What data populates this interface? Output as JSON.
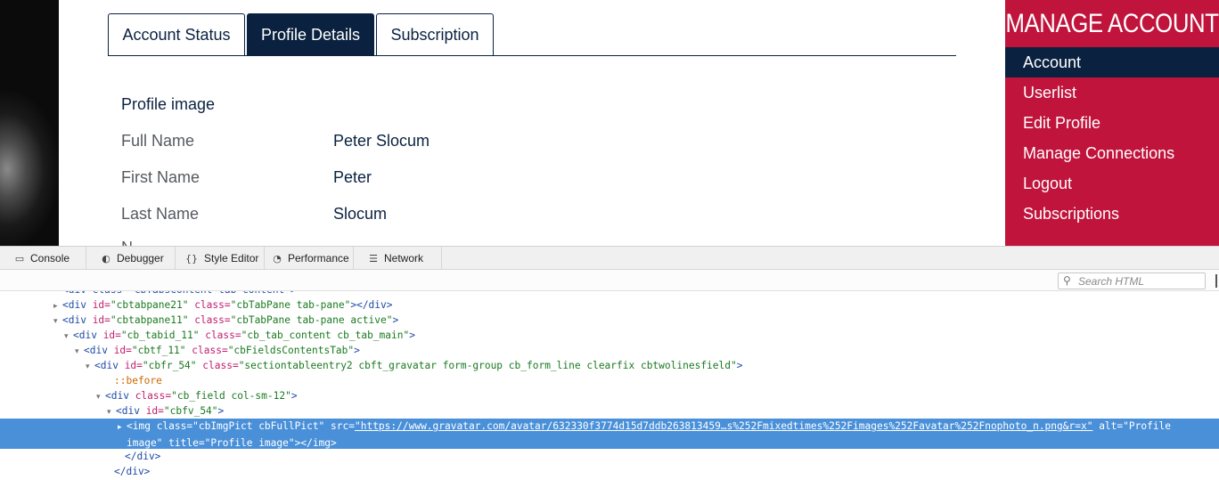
{
  "page": {
    "tabs": [
      {
        "label": "Account Status",
        "active": false
      },
      {
        "label": "Profile Details",
        "active": true
      },
      {
        "label": "Subscription",
        "active": false
      }
    ],
    "profile_image_label": "Profile image",
    "fields": [
      {
        "label": "Full Name",
        "value": "Peter Slocum"
      },
      {
        "label": "First Name",
        "value": "Peter"
      },
      {
        "label": "Last Name",
        "value": "Slocum"
      }
    ],
    "partial_label": "N",
    "sidebar": {
      "title": "MANAGE ACCOUNT",
      "items": [
        {
          "label": "Account",
          "active": true
        },
        {
          "label": "Userlist",
          "active": false
        },
        {
          "label": "Edit Profile",
          "active": false
        },
        {
          "label": "Manage Connections",
          "active": false
        },
        {
          "label": "Logout",
          "active": false
        },
        {
          "label": "Subscriptions",
          "active": false
        }
      ]
    },
    "colors": {
      "navy": "#0a2240",
      "crimson": "#c0143c",
      "selection": "#4a90d9"
    }
  },
  "devtools": {
    "tabs": [
      {
        "label": "Console",
        "icon": "console-icon"
      },
      {
        "label": "Debugger",
        "icon": "debugger-icon"
      },
      {
        "label": "Style Editor",
        "icon": "style-editor-icon"
      },
      {
        "label": "Performance",
        "icon": "performance-icon"
      },
      {
        "label": "Network",
        "icon": "network-icon"
      }
    ],
    "search_placeholder": "Search HTML",
    "tree": [
      {
        "tw": "",
        "parts": [
          [
            "t",
            "<div class=\"cbTabsContent tab-content\">"
          ]
        ]
      },
      {
        "tw": "▸",
        "parts": [
          [
            "t",
            "<div "
          ],
          [
            "a",
            "id="
          ],
          [
            "v",
            "\"cbtabpane21\""
          ],
          [
            "a",
            " class="
          ],
          [
            "v",
            "\"cbTabPane tab-pane\""
          ],
          [
            "t",
            "></div>"
          ]
        ]
      },
      {
        "tw": "▾",
        "parts": [
          [
            "t",
            "<div "
          ],
          [
            "a",
            "id="
          ],
          [
            "v",
            "\"cbtabpane11\""
          ],
          [
            "a",
            " class="
          ],
          [
            "v",
            "\"cbTabPane tab-pane active\""
          ],
          [
            "t",
            ">"
          ]
        ]
      },
      {
        "tw": "▾",
        "parts": [
          [
            "t",
            "<div "
          ],
          [
            "a",
            "id="
          ],
          [
            "v",
            "\"cb_tabid_11\""
          ],
          [
            "a",
            " class="
          ],
          [
            "v",
            "\"cb_tab_content cb_tab_main\""
          ],
          [
            "t",
            ">"
          ]
        ]
      },
      {
        "tw": "▾",
        "parts": [
          [
            "t",
            "<div "
          ],
          [
            "a",
            "id="
          ],
          [
            "v",
            "\"cbtf_11\""
          ],
          [
            "a",
            " class="
          ],
          [
            "v",
            "\"cbFieldsContentsTab\""
          ],
          [
            "t",
            ">"
          ]
        ]
      },
      {
        "tw": "▾",
        "parts": [
          [
            "t",
            "<div "
          ],
          [
            "a",
            "id="
          ],
          [
            "v",
            "\"cbfr_54\""
          ],
          [
            "a",
            " class="
          ],
          [
            "v",
            "\"sectiontableentry2 cbft_gravatar form-group cb_form_line clearfix cbtwolinesfield\""
          ],
          [
            "t",
            ">"
          ]
        ]
      },
      {
        "tw": "",
        "parts": [
          [
            "p",
            "::before"
          ]
        ]
      },
      {
        "tw": "▾",
        "parts": [
          [
            "t",
            "<div "
          ],
          [
            "a",
            "class="
          ],
          [
            "v",
            "\"cb_field col-sm-12\""
          ],
          [
            "t",
            ">"
          ]
        ]
      },
      {
        "tw": "▾",
        "parts": [
          [
            "t",
            "<div "
          ],
          [
            "a",
            "id="
          ],
          [
            "v",
            "\"cbfv_54\""
          ],
          [
            "t",
            ">"
          ]
        ]
      },
      {
        "tw": "▸",
        "parts": [
          [
            "t",
            "<img "
          ],
          [
            "a",
            "class="
          ],
          [
            "v",
            "\"cbImgPict cbFullPict\""
          ],
          [
            "a",
            " src="
          ],
          [
            "l",
            "\"https://www.gravatar.com/avatar/632330f3774d15d7ddb263813459…s%252Fmixedtimes%252Fimages%252Favatar%252Fnophoto_n.png&r=x\""
          ],
          [
            "a",
            " alt="
          ],
          [
            "v",
            "\"Profile"
          ]
        ],
        "cont": [
          [
            "v",
            "image\""
          ],
          [
            "a",
            " title="
          ],
          [
            "v",
            "\"Profile image\""
          ],
          [
            "t",
            "></img>"
          ]
        ]
      },
      {
        "tw": "",
        "parts": [
          [
            "t",
            "</div>"
          ]
        ]
      },
      {
        "tw": "",
        "parts": [
          [
            "t",
            "</div>"
          ]
        ]
      }
    ]
  }
}
